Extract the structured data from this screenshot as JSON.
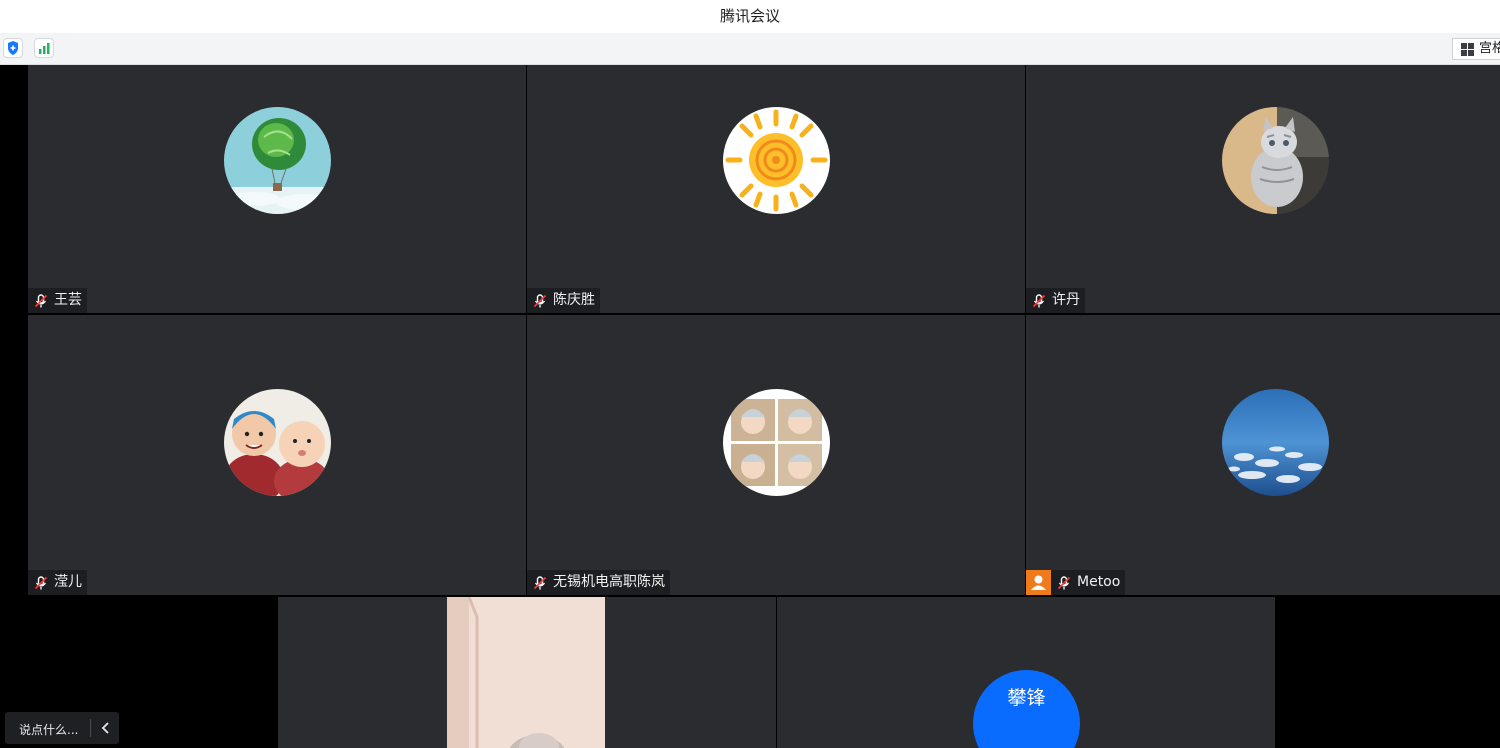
{
  "window": {
    "title": "腾讯会议"
  },
  "toolbar": {
    "security_icon": "shield-check-icon",
    "network_icon": "signal-bars-icon",
    "view_label": "宫格视图"
  },
  "participants": [
    {
      "name": "王芸",
      "avatar": "balloon-image",
      "mic": "muted"
    },
    {
      "name": "陈庆胜",
      "avatar": "sun-drawing-image",
      "mic": "muted"
    },
    {
      "name": "许丹",
      "avatar": "cat-photo-image",
      "mic": "muted"
    },
    {
      "name": "滢儿",
      "avatar": "children-photo-image",
      "mic": "muted"
    },
    {
      "name": "无锡机电高职陈岚",
      "avatar": "baby-collage-image",
      "mic": "muted"
    },
    {
      "name": "Metoo",
      "avatar": "sky-clouds-image",
      "mic": "muted",
      "host": true
    },
    {
      "name": "",
      "avatar": "video-stream",
      "mic": ""
    },
    {
      "name": "攀锋",
      "avatar": "text-avatar",
      "avatar_text": "攀锋",
      "avatar_color": "#0a6cff",
      "mic": ""
    }
  ],
  "chat": {
    "placeholder": "说点什么...",
    "collapse_icon": "chevron-left-icon"
  },
  "colors": {
    "tile_bg": "#2a2c30",
    "host_badge": "#f07b1d",
    "text_avatar": "#0a6cff"
  }
}
